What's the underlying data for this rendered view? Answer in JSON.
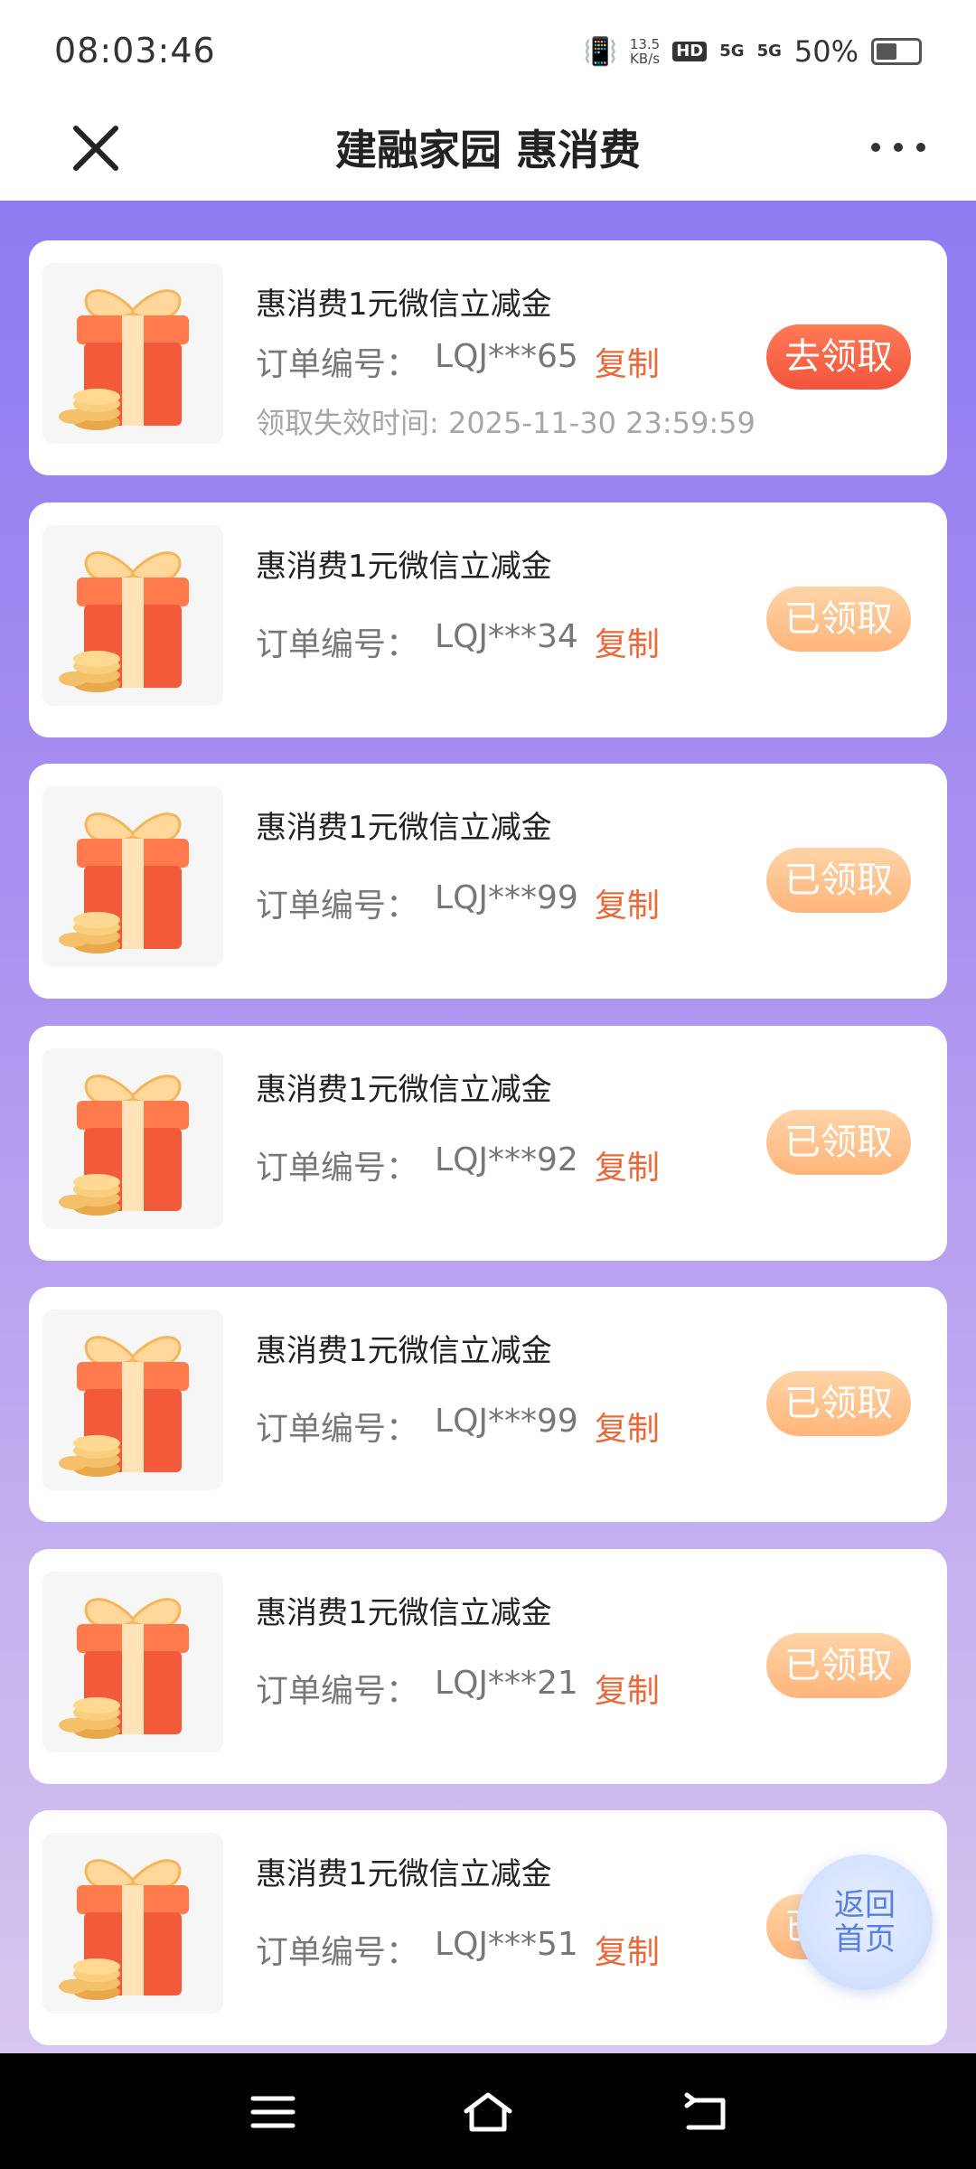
{
  "status_bar": {
    "time": "08:03:46",
    "speed_top": "13.5",
    "speed_bottom": "KB/s",
    "hd": "HD",
    "sig1": "5G",
    "sig2": "5G",
    "battery": "50%"
  },
  "header": {
    "title": "建融家园 惠消费"
  },
  "cards": [
    {
      "title": "惠消费1元微信立减金",
      "order_label": "订单编号：",
      "order_no": "LQJ***65",
      "copy_label": "复制",
      "expire": "领取失效时间: 2025-11-30 23:59:59",
      "button": "去领取",
      "state": "active"
    },
    {
      "title": "惠消费1元微信立减金",
      "order_label": "订单编号：",
      "order_no": "LQJ***34",
      "copy_label": "复制",
      "button": "已领取",
      "state": "done"
    },
    {
      "title": "惠消费1元微信立减金",
      "order_label": "订单编号：",
      "order_no": "LQJ***99",
      "copy_label": "复制",
      "button": "已领取",
      "state": "done"
    },
    {
      "title": "惠消费1元微信立减金",
      "order_label": "订单编号：",
      "order_no": "LQJ***92",
      "copy_label": "复制",
      "button": "已领取",
      "state": "done"
    },
    {
      "title": "惠消费1元微信立减金",
      "order_label": "订单编号：",
      "order_no": "LQJ***99",
      "copy_label": "复制",
      "button": "已领取",
      "state": "done"
    },
    {
      "title": "惠消费1元微信立减金",
      "order_label": "订单编号：",
      "order_no": "LQJ***21",
      "copy_label": "复制",
      "button": "已领取",
      "state": "done"
    },
    {
      "title": "惠消费1元微信立减金",
      "order_label": "订单编号：",
      "order_no": "LQJ***51",
      "copy_label": "复制",
      "button": "已领取",
      "state": "done"
    }
  ],
  "fab": {
    "line1": "返回",
    "line2": "首页"
  },
  "colors": {
    "accent_copy": "#e86a3b",
    "active_button": "#f2553c",
    "done_button": "#ffb57a",
    "gradient_top": "#8f7bf1",
    "gradient_bottom": "#d7c6ef"
  }
}
